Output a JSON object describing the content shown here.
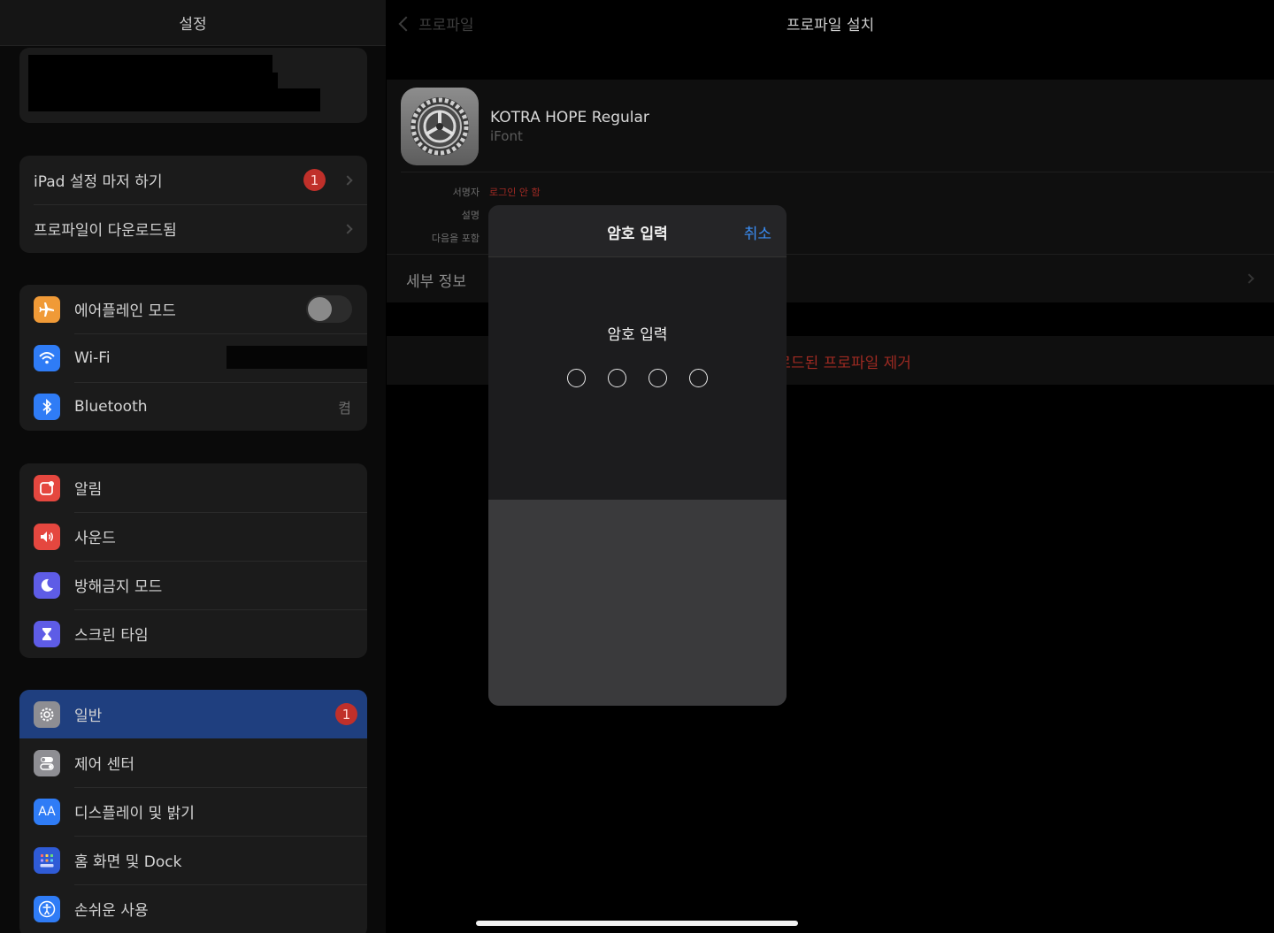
{
  "sidebar": {
    "title": "설정",
    "setup_rows": [
      {
        "label": "iPad 설정 마저 하기",
        "badge": "1"
      },
      {
        "label": "프로파일이 다운로드됨"
      }
    ],
    "connectivity": [
      {
        "label": "에어플레인 모드",
        "icon": "airplane-icon",
        "color": "#f09a37",
        "toggle": false
      },
      {
        "label": "Wi-Fi",
        "icon": "wifi-icon",
        "color": "#2f7cf6"
      },
      {
        "label": "Bluetooth",
        "icon": "bluetooth-icon",
        "color": "#2f7cf6",
        "value": "켬"
      }
    ],
    "notifications": [
      {
        "label": "알림",
        "icon": "notifications-icon",
        "color": "#e5473f"
      },
      {
        "label": "사운드",
        "icon": "sound-icon",
        "color": "#e5473f"
      },
      {
        "label": "방해금지 모드",
        "icon": "moon-icon",
        "color": "#5e5ce6"
      },
      {
        "label": "스크린 타임",
        "icon": "hourglass-icon",
        "color": "#5e5ce6"
      }
    ],
    "general": [
      {
        "label": "일반",
        "icon": "gear-icon",
        "color": "#8e8e93",
        "badge": "1",
        "selected": true
      },
      {
        "label": "제어 센터",
        "icon": "control-center-icon",
        "color": "#8e8e93"
      },
      {
        "label": "디스플레이 및 밝기",
        "icon": "display-icon",
        "color": "#2f7cf6",
        "glyph": "AA"
      },
      {
        "label": "홈 화면 및 Dock",
        "icon": "home-screen-icon",
        "color": "#2f5bd6"
      },
      {
        "label": "손쉬운 사용",
        "icon": "accessibility-icon",
        "color": "#2f7cf6"
      }
    ]
  },
  "main": {
    "back_label": "프로파일",
    "title": "프로파일 설치",
    "profile": {
      "name": "KOTRA HOPE Regular",
      "subtitle": "iFont",
      "signer_label": "서명자",
      "signer_value": "로그인 안 함",
      "description_label": "설명",
      "contains_label": "다음을 포함",
      "details_label": "세부 정보"
    },
    "remove_label": "다운로드된 프로파일 제거"
  },
  "modal": {
    "title": "암호 입력",
    "cancel_label": "취소",
    "prompt": "암호 입력",
    "digits": 4
  }
}
